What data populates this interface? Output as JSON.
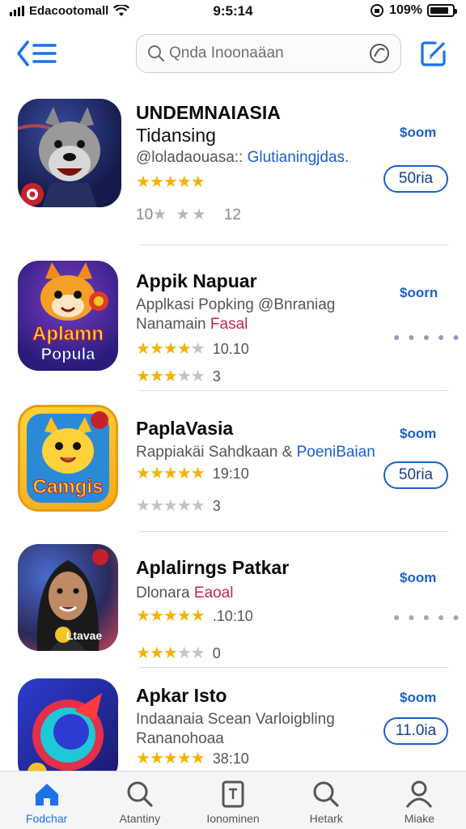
{
  "status_bar": {
    "carrier": "Edacootomall",
    "time": "9:5:14",
    "battery": "109%",
    "battery_level": 0.85
  },
  "nav": {
    "back_icon": "chevron-list-icon",
    "search_placeholder": "Qnda Inoonaäan",
    "compose_icon": "compose-icon"
  },
  "apps": [
    {
      "title": "UNDEMNAIASIA",
      "subtitle": "Tidansing",
      "developer": "@loladaouasa:: ",
      "developer_highlight": "Glutianingjdas.",
      "rating_stars": 4.5,
      "price": "$oom",
      "button": "50ria",
      "meta": "10",
      "meta_count": "12",
      "meta_stars": "★ ★★",
      "icon_colors": [
        "#1a2b6b",
        "#c83a2a"
      ]
    },
    {
      "title": "Appik Napuar",
      "subtitle": "Applkasi Popking @Bnraniag",
      "developer": "Nanamain ",
      "developer_highlight": "Fasal",
      "rating_stars": 3.5,
      "rating_value": "10.10",
      "rating2_stars": 3,
      "rating2_value": "3",
      "price": "$oorn",
      "icon_label_1": "Aplamn",
      "icon_label_2": "Popula",
      "icon_colors": [
        "#3b2fa0",
        "#d8417a"
      ]
    },
    {
      "title": "PaplaVasia",
      "subtitle": "Rappiakäi Sahdkaan & ",
      "subtitle_highlight": "PoeniBaian",
      "rating_stars": 5,
      "rating_value": "19:10",
      "rating2_stars": 0,
      "rating2_value": "3",
      "price": "$oom",
      "button": "50ria",
      "icon_label": "Camgis",
      "icon_colors": [
        "#f5b81c",
        "#2a8ad8"
      ]
    },
    {
      "title": "Aplalirngs Patkar",
      "subtitle": "Dlonara ",
      "subtitle_highlight": "Eaoal",
      "rating_stars": 4.5,
      "rating_value": ".10:10",
      "rating2_stars": 3,
      "rating2_value": "0",
      "price": "$oom",
      "icon_label": "Ltavae",
      "icon_colors": [
        "#2a2f6a",
        "#c9445a"
      ]
    },
    {
      "title": "Apkar Isto",
      "subtitle": "Indaanaia Scean Varloigbling",
      "developer": "Rananohoaa",
      "rating_stars": 5,
      "rating_value": "38:10",
      "price": "$oom",
      "button": "11.0ia",
      "icon_colors": [
        "#2d3bd0",
        "#e22f4a"
      ]
    }
  ],
  "tabs": [
    {
      "label": "Fodchar",
      "icon": "home-icon",
      "active": true
    },
    {
      "label": "Atantiny",
      "icon": "search-icon",
      "active": false
    },
    {
      "label": "Ionominen",
      "icon": "document-icon",
      "active": false
    },
    {
      "label": "Hetark",
      "icon": "search-icon",
      "active": false
    },
    {
      "label": "Miake",
      "icon": "person-icon",
      "active": false
    }
  ],
  "colors": {
    "accent": "#1a73e8",
    "price": "#1a5fcf",
    "star": "#f2b300"
  }
}
